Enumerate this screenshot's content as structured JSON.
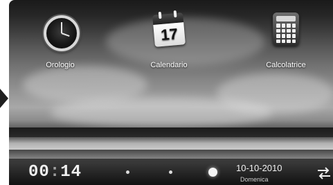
{
  "apps": [
    {
      "name": "clock",
      "label": "Orologio"
    },
    {
      "name": "calendar",
      "label": "Calendario",
      "calendar_day": "17"
    },
    {
      "name": "calculator",
      "label": "Calcolatrice"
    }
  ],
  "status": {
    "time_hours": "00",
    "time_separator": ":",
    "time_minutes": "14",
    "date": "10-10-2010",
    "day": "Domenica",
    "page_count": 3,
    "active_page_index": 2
  },
  "colors": {
    "status_bar": "#1a1a1a",
    "text_light": "#f0f0f0"
  },
  "icons": {
    "left_arrow": "left-arrow-icon",
    "swap": "swap-arrows-icon"
  }
}
